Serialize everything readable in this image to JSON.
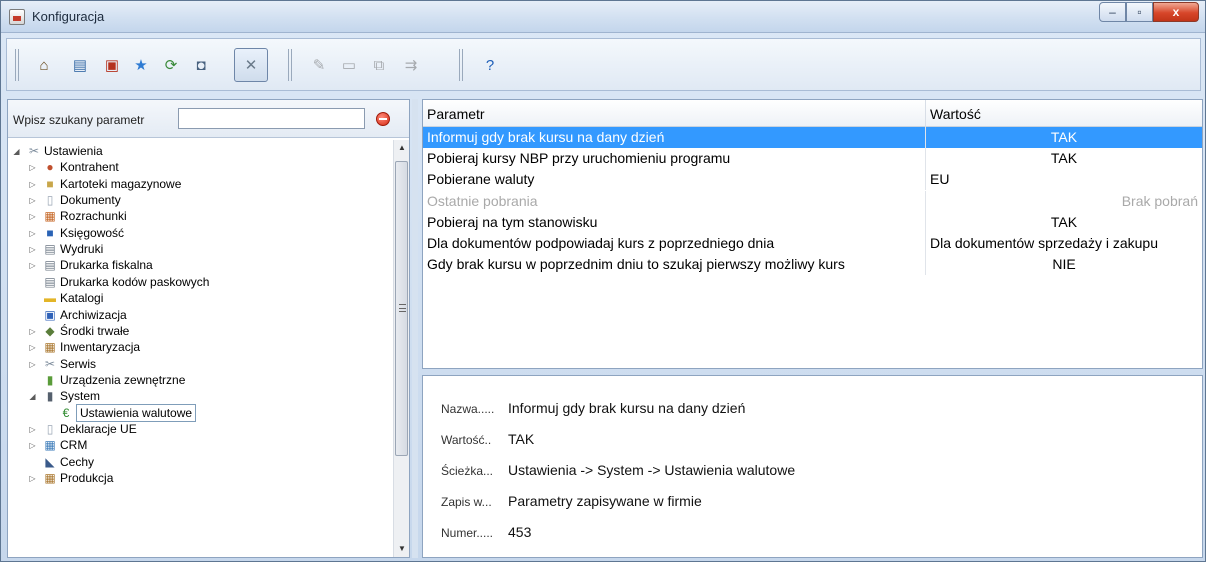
{
  "window": {
    "title": "Konfiguracja",
    "buttons": {
      "minimize": "–",
      "maximize": "▫",
      "close": "x"
    }
  },
  "toolbar": {
    "icons": [
      {
        "name": "home-icon",
        "glyph": "⌂",
        "color": "#6a4d1f",
        "enabled": true
      },
      {
        "name": "card-file-icon",
        "glyph": "▤",
        "color": "#3b6ea8",
        "enabled": true
      },
      {
        "name": "users-icon",
        "glyph": "▣",
        "color": "#b5321f",
        "enabled": true
      },
      {
        "name": "star-icon",
        "glyph": "★",
        "color": "#2e7bd3",
        "enabled": true
      },
      {
        "name": "refresh-icon",
        "glyph": "⟳",
        "color": "#3a8a3a",
        "enabled": true
      },
      {
        "name": "database-icon",
        "glyph": "◘",
        "color": "#48617f",
        "enabled": true
      },
      {
        "name": "tools-icon",
        "glyph": "✕",
        "color": "#6a7a8a",
        "enabled": true,
        "active": true
      },
      {
        "name": "edit-icon",
        "glyph": "✎",
        "color": "#555555",
        "enabled": false
      },
      {
        "name": "new-document-icon",
        "glyph": "▭",
        "color": "#555555",
        "enabled": false
      },
      {
        "name": "copy-icon",
        "glyph": "⧉",
        "color": "#555555",
        "enabled": false
      },
      {
        "name": "export-icon",
        "glyph": "⇉",
        "color": "#555555",
        "enabled": false
      },
      {
        "name": "help-icon",
        "glyph": "?",
        "color": "#1f5fb8",
        "enabled": true
      }
    ]
  },
  "search": {
    "label": "Wpisz szukany parametr",
    "value": "",
    "placeholder": ""
  },
  "tree": {
    "items": [
      {
        "label": "Ustawienia",
        "level": 0,
        "expander": "◢",
        "icon": "tools-icon",
        "glyph": "✂",
        "color": "#7b8a9a"
      },
      {
        "label": "Kontrahent",
        "level": 1,
        "expander": "▷",
        "icon": "contacts-icon",
        "glyph": "●",
        "color": "#c0502e"
      },
      {
        "label": "Kartoteki magazynowe",
        "level": 1,
        "expander": "▷",
        "icon": "warehouse-icon",
        "glyph": "■",
        "color": "#c8a64a"
      },
      {
        "label": "Dokumenty",
        "level": 1,
        "expander": "▷",
        "icon": "document-icon",
        "glyph": "▯",
        "color": "#9aa6b4"
      },
      {
        "label": "Rozrachunki",
        "level": 1,
        "expander": "▷",
        "icon": "settlements-icon",
        "glyph": "▦",
        "color": "#c4621f"
      },
      {
        "label": "Księgowość",
        "level": 1,
        "expander": "▷",
        "icon": "accounting-book-icon",
        "glyph": "■",
        "color": "#2a63b5"
      },
      {
        "label": "Wydruki",
        "level": 1,
        "expander": "▷",
        "icon": "printer-icon",
        "glyph": "▤",
        "color": "#6d7885"
      },
      {
        "label": "Drukarka fiskalna",
        "level": 1,
        "expander": "▷",
        "icon": "fiscal-printer-icon",
        "glyph": "▤",
        "color": "#6d7885"
      },
      {
        "label": "Drukarka kodów paskowych",
        "level": 1,
        "expander": "",
        "icon": "barcode-printer-icon",
        "glyph": "▤",
        "color": "#6d7885"
      },
      {
        "label": "Katalogi",
        "level": 1,
        "expander": "",
        "icon": "folder-icon",
        "glyph": "▬",
        "color": "#e3b528"
      },
      {
        "label": "Archiwizacja",
        "level": 1,
        "expander": "",
        "icon": "floppy-disk-icon",
        "glyph": "▣",
        "color": "#2f62b8"
      },
      {
        "label": "Środki trwałe",
        "level": 1,
        "expander": "▷",
        "icon": "fixed-assets-icon",
        "glyph": "◆",
        "color": "#5a7d3a"
      },
      {
        "label": "Inwentaryzacja",
        "level": 1,
        "expander": "▷",
        "icon": "inventory-icon",
        "glyph": "▦",
        "color": "#a8742a"
      },
      {
        "label": "Serwis",
        "level": 1,
        "expander": "▷",
        "icon": "service-tools-icon",
        "glyph": "✂",
        "color": "#7b8a9a"
      },
      {
        "label": "Urządzenia zewnętrzne",
        "level": 1,
        "expander": "",
        "icon": "external-device-icon",
        "glyph": "▮",
        "color": "#5a9c3a"
      },
      {
        "label": "System",
        "level": 1,
        "expander": "◢",
        "icon": "computer-icon",
        "glyph": "▮",
        "color": "#55606d"
      },
      {
        "label": "Ustawienia walutowe",
        "level": 2,
        "expander": "",
        "icon": "currency-icon",
        "glyph": "€",
        "color": "#2e8a2e",
        "selected": true
      },
      {
        "label": "Deklaracje UE",
        "level": 1,
        "expander": "▷",
        "icon": "declaration-icon",
        "glyph": "▯",
        "color": "#9aa6b4"
      },
      {
        "label": "CRM",
        "level": 1,
        "expander": "▷",
        "icon": "crm-icon",
        "glyph": "▦",
        "color": "#3a7ab8"
      },
      {
        "label": "Cechy",
        "level": 1,
        "expander": "",
        "icon": "features-icon",
        "glyph": "◣",
        "color": "#3a5a8a"
      },
      {
        "label": "Produkcja",
        "level": 1,
        "expander": "▷",
        "icon": "production-icon",
        "glyph": "▦",
        "color": "#a8742a"
      }
    ]
  },
  "grid": {
    "headers": [
      "Parametr",
      "Wartość"
    ],
    "rows": [
      {
        "param": "Informuj gdy brak kursu na dany dzień",
        "value": "TAK",
        "align": "center",
        "state": "selected"
      },
      {
        "param": "Pobieraj kursy NBP przy uruchomieniu programu",
        "value": "TAK",
        "align": "center",
        "state": "normal"
      },
      {
        "param": "Pobierane waluty",
        "value": "EU",
        "align": "left",
        "state": "normal"
      },
      {
        "param": "Ostatnie pobrania",
        "value": "Brak pobrań",
        "align": "right",
        "state": "disabled"
      },
      {
        "param": "Pobieraj na tym stanowisku",
        "value": "TAK",
        "align": "center",
        "state": "normal"
      },
      {
        "param": "Dla dokumentów podpowiadaj kurs z poprzedniego dnia",
        "value": "Dla dokumentów sprzedaży i zakupu",
        "align": "left",
        "state": "normal"
      },
      {
        "param": "Gdy brak kursu w poprzednim dniu to szukaj pierwszy możliwy kurs",
        "value": "NIE",
        "align": "center",
        "state": "normal"
      }
    ]
  },
  "detail": {
    "rows": [
      {
        "label": "Nazwa.....",
        "value": "Informuj gdy brak kursu na dany dzień"
      },
      {
        "label": "Wartość..",
        "value": "TAK"
      },
      {
        "label": "Ścieżka...",
        "value": "Ustawienia -> System -> Ustawienia walutowe"
      },
      {
        "label": "Zapis w...",
        "value": "Parametry zapisywane w firmie"
      },
      {
        "label": "Numer.....",
        "value": "453"
      }
    ]
  }
}
